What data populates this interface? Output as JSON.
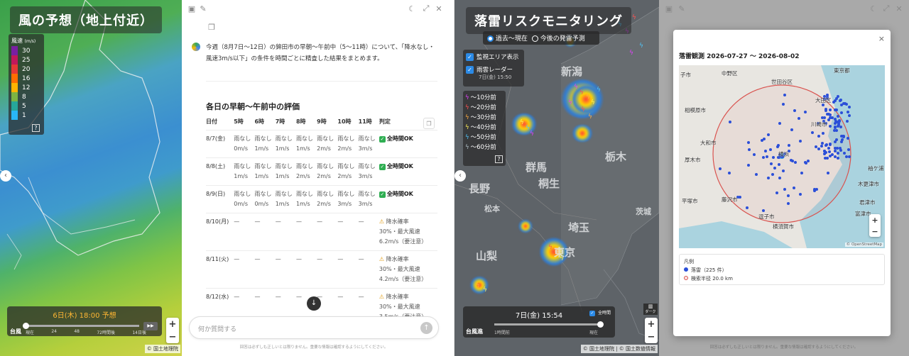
{
  "wind": {
    "title": "風の予想（地上付近）",
    "legend_title": "風速",
    "legend_unit": "(m/s)",
    "legend_values": [
      "30",
      "25",
      "20",
      "16",
      "12",
      "8",
      "5",
      "1"
    ],
    "legend_colors": [
      "#7a1fa2",
      "#c2185b",
      "#e53935",
      "#ff6d00",
      "#ffb300",
      "#7cb342",
      "#26a69a",
      "#29b6f6"
    ],
    "help": "?",
    "time_label": "6日(木) 18:00 予想",
    "timeline_ticks": [
      "現在",
      "24",
      "48",
      "72時間後",
      "14日後"
    ],
    "layer_label": "台風",
    "play_icon": "▶▶",
    "zoom_in": "+",
    "zoom_out": "−",
    "attribution": "© 国土地理院"
  },
  "chat": {
    "intro_line1": "今週（8月7日〜12日）の鉾田市の早朝〜午前中（5〜11時）について、「降水なし・",
    "intro_line2": "風速3m/s以下」の条件を時間ごとに精査した結果をまとめます。",
    "section_title": "各日の早朝〜午前中の評価",
    "headers": [
      "日付",
      "5時",
      "6時",
      "7時",
      "8時",
      "9時",
      "10時",
      "11時",
      "判定"
    ],
    "rows": [
      {
        "date": "8/7(金)",
        "cells": [
          [
            "雨なし",
            "0m/s"
          ],
          [
            "雨なし",
            "1m/s"
          ],
          [
            "雨なし",
            "1m/s"
          ],
          [
            "雨なし",
            "1m/s"
          ],
          [
            "雨なし",
            "2m/s"
          ],
          [
            "雨なし",
            "2m/s"
          ],
          [
            "雨なし",
            "3m/s"
          ]
        ],
        "verdict": "全時間OK",
        "type": "ok"
      },
      {
        "date": "8/8(土)",
        "cells": [
          [
            "雨なし",
            "1m/s"
          ],
          [
            "雨なし",
            "1m/s"
          ],
          [
            "雨なし",
            "1m/s"
          ],
          [
            "雨なし",
            "2m/s"
          ],
          [
            "雨なし",
            "2m/s"
          ],
          [
            "雨なし",
            "2m/s"
          ],
          [
            "雨なし",
            "3m/s"
          ]
        ],
        "verdict": "全時間OK",
        "type": "ok"
      },
      {
        "date": "8/9(日)",
        "cells": [
          [
            "雨なし",
            "0m/s"
          ],
          [
            "雨なし",
            "0m/s"
          ],
          [
            "雨なし",
            "1m/s"
          ],
          [
            "雨なし",
            "1m/s"
          ],
          [
            "雨なし",
            "2m/s"
          ],
          [
            "雨なし",
            "3m/s"
          ],
          [
            "雨なし",
            "3m/s"
          ]
        ],
        "verdict": "全時間OK",
        "type": "ok"
      },
      {
        "date": "8/10(月)",
        "cells": [
          [
            "—"
          ],
          [
            "—"
          ],
          [
            "—"
          ],
          [
            "—"
          ],
          [
            "—"
          ],
          [
            "—"
          ],
          [
            "—"
          ]
        ],
        "verdict": "降水確率|30%・最大風速|6.2m/s（要注意）",
        "type": "warn"
      },
      {
        "date": "8/11(火)",
        "cells": [
          [
            "—"
          ],
          [
            "—"
          ],
          [
            "—"
          ],
          [
            "—"
          ],
          [
            "—"
          ],
          [
            "—"
          ],
          [
            "—"
          ]
        ],
        "verdict": "降水確率|30%・最大風速|4.2m/s（要注意）",
        "type": "warn"
      },
      {
        "date": "8/12(水)",
        "cells": [
          [
            "—"
          ],
          [
            "—"
          ],
          [
            "—"
          ],
          [
            "—"
          ],
          [
            "—"
          ],
          [
            "—"
          ],
          [
            "—"
          ]
        ],
        "verdict": "降水確率|30%・最大風速|3.5m/s（要注意）",
        "type": "warn"
      }
    ],
    "input_placeholder": "何か質問する",
    "disclaimer": "回答は必ずしも正しいとは限りません。重要な情報は確認するようにしてください。"
  },
  "lightning": {
    "title": "落雷リスクモニタリング",
    "radio_past": "過去〜現在",
    "radio_future": "今後の発雷予測",
    "check_area": "監視エリア表示",
    "check_radar": "雨雲レーダー",
    "radar_time": "7日(金) 15:50",
    "legend": [
      {
        "label": "〜10分前",
        "color": "#e040fb"
      },
      {
        "label": "〜20分前",
        "color": "#ff5252"
      },
      {
        "label": "〜30分前",
        "color": "#ffab40"
      },
      {
        "label": "〜40分前",
        "color": "#ffee58"
      },
      {
        "label": "〜50分前",
        "color": "#4fc3f7"
      },
      {
        "label": "〜60分前",
        "color": "#b0bec5"
      }
    ],
    "help": "?",
    "places": [
      "新潟",
      "長野",
      "群馬",
      "桐生",
      "栃木",
      "埼玉",
      "山梨",
      "東京",
      "茨城",
      "松本"
    ],
    "time_label": "7日(金) 15:54",
    "all_time": "全時間",
    "layer_label": "台風進",
    "tick_left": "1時間前",
    "tick_right": "現在",
    "dark_label": "ダーク",
    "zoom_in": "+",
    "zoom_out": "−",
    "attribution": "© 国土地理院 | © 国土数値情報"
  },
  "modal": {
    "title": "落雷観測 2026-07-27 〜 2026-08-02",
    "close": "×",
    "places": [
      "子市",
      "中野区",
      "世田谷区",
      "東京都",
      "相模原市",
      "大田区",
      "川崎市",
      "大和市",
      "厚木市",
      "横浜",
      "袖ケ浦",
      "木更津市",
      "平塚市",
      "藤沢市",
      "君津市",
      "富津市",
      "逗子市",
      "横須賀市"
    ],
    "legend_title": "凡例",
    "legend_strike": "落雷（225 件）",
    "legend_radius": "検索半径 20.0 km",
    "map_attr": "© OpenStreetMap",
    "zoom_in": "+",
    "zoom_out": "−",
    "disclaimer": "回答は必ずしも正しいとは限りません。重要な情報は確認するようにしてください。"
  }
}
